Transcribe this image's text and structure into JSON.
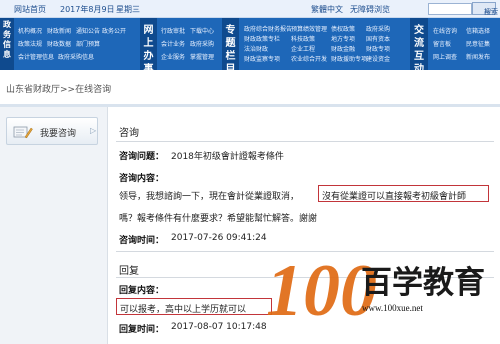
{
  "topbar": {
    "home": "网站首页",
    "date": "2017年8月9日",
    "weekday": "星期三",
    "lang": "繁體中文",
    "accessibility": "无障碍浏览",
    "search_label": "搜索"
  },
  "nav": {
    "sec1_title": "政务信息",
    "sec1_links": [
      "机构概况",
      "财政新闻",
      "通知公告",
      "政策法规",
      "财政数据",
      "部门预算",
      "会计管理信息",
      "政府采购信息",
      "政务公开"
    ],
    "sec2_title": "网上办事",
    "sec2_links": [
      "行政审批",
      "下载中心",
      "会计业务",
      "政府采购",
      "企业服务",
      "掌握管理"
    ],
    "sec3_title": "专题栏目",
    "sec3_links": [
      "政府综合财务报告",
      "预算绩效管理",
      "债权政策",
      "财政政策专栏",
      "科技政策",
      "地方专项",
      "法治财政",
      "企业工程",
      "财政金融",
      "财政监察专项",
      "农业综合开发",
      "财政援助专项",
      "政府采购",
      "国有资本",
      "财政专项",
      "建设资金"
    ],
    "sec4_title": "交流互动",
    "sec4_links": [
      "在线咨询",
      "信箱选择",
      "留言板",
      "民意征集",
      "网上调查",
      "新闻发布"
    ]
  },
  "breadcrumb": "山东省财政厅>>在线咨询",
  "left": {
    "ask_label": "我要咨询",
    "arrow": "▷"
  },
  "consult": {
    "section_title": "咨询",
    "q_label": "咨询问题：",
    "q_value": "2018年初级會計證報考條件",
    "content_label": "咨询内容：",
    "content_line1_a": "领导，我想諮詢一下，現在會計從業證取消，",
    "content_line1_b": "沒有從業證可以直接報考初級會計師",
    "content_line2": "嗎？報考條件有什麼要求？希望能幫忙解答。謝謝",
    "time_label": "咨询时间：",
    "time_value": "2017-07-26 09:41:24"
  },
  "reply": {
    "section_title": "回复",
    "content_label": "回复内容：",
    "content_value": "可以报考，高中以上学历就可以",
    "time_label": "回复时间：",
    "time_value": "2017-08-07 10:17:48"
  },
  "watermark": {
    "number": "100",
    "chinese": "百学教育",
    "url": "www.100xue.net"
  }
}
